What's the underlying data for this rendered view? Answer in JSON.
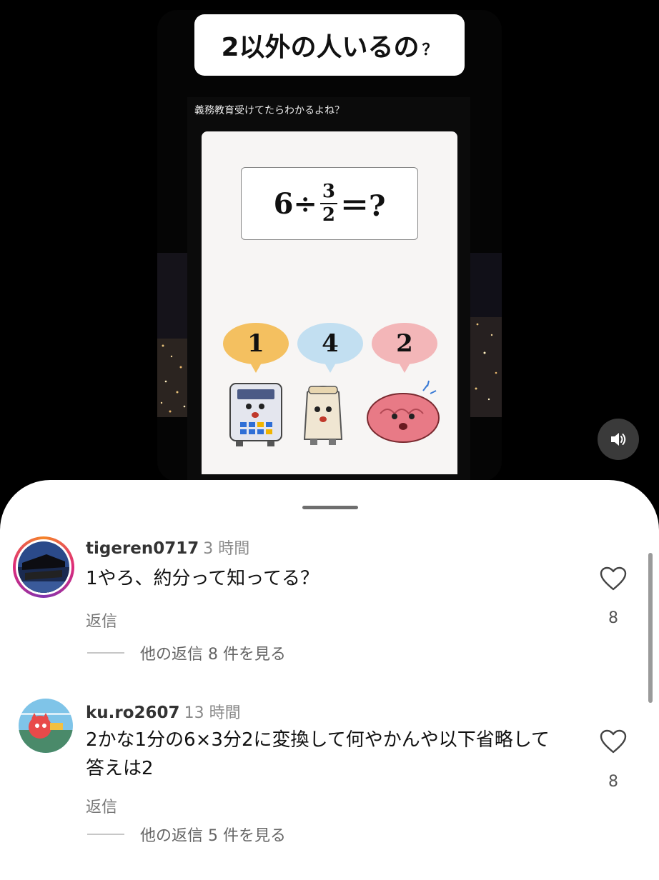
{
  "video": {
    "title": "2以外の人いるの",
    "title_mark": "？",
    "inner_caption": "義務教育受けてたらわかるよね？",
    "equation": {
      "left": "6÷",
      "numerator": "3",
      "denominator": "2",
      "right": "＝?"
    },
    "choices": [
      "1",
      "4",
      "2"
    ],
    "colors": {
      "choice1": "#f4c060",
      "choice2": "#c2dff1",
      "choice3": "#f3b6b8"
    },
    "sound_icon": "speaker-icon"
  },
  "comments": [
    {
      "username": "tigeren0717",
      "time": "3 時間",
      "text": "1やろ、約分って知ってる？",
      "reply_label": "返信",
      "view_replies": "他の返信 8 件を見る",
      "likes": "8"
    },
    {
      "username": "ku.ro2607",
      "time": "13 時間",
      "text": "2かな1分の6×3分2に変換して何やかんや以下省略して答えは2",
      "reply_label": "返信",
      "view_replies": "他の返信 5 件を見る",
      "likes": "8"
    }
  ]
}
